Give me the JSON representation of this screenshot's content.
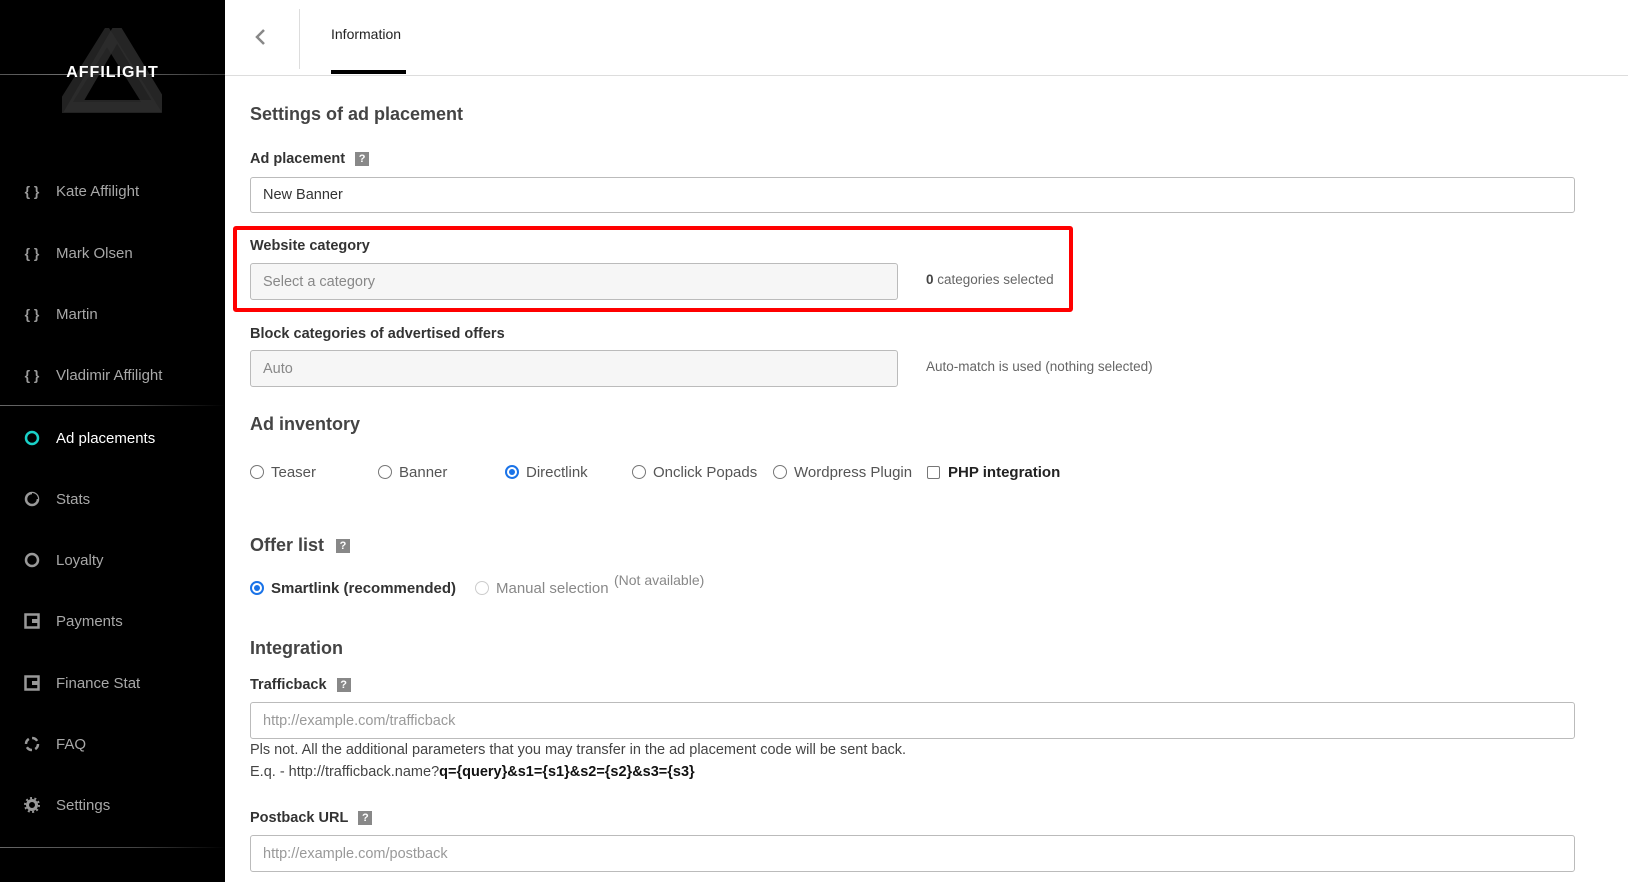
{
  "sidebar": {
    "logo_text": "AFFILIGHT",
    "accounts": [
      {
        "label": "Kate Affilight",
        "icon": "braces-icon"
      },
      {
        "label": "Mark Olsen",
        "icon": "braces-icon"
      },
      {
        "label": "Martin",
        "icon": "braces-icon"
      },
      {
        "label": "Vladimir Affilight",
        "icon": "braces-icon"
      }
    ],
    "items": [
      {
        "label": "Ad placements",
        "icon": "circle-icon",
        "active": true
      },
      {
        "label": "Stats",
        "icon": "pie-icon"
      },
      {
        "label": "Loyalty",
        "icon": "circle-icon"
      },
      {
        "label": "Payments",
        "icon": "wallet-icon"
      },
      {
        "label": "Finance Stat",
        "icon": "wallet-icon"
      },
      {
        "label": "FAQ",
        "icon": "lifebuoy-icon"
      },
      {
        "label": "Settings",
        "icon": "gear-icon"
      }
    ],
    "accent_color": "#1ad1c8"
  },
  "topbar": {
    "back_icon": "chevron-left-icon",
    "tabs": [
      {
        "label": "Information",
        "active": true
      }
    ]
  },
  "form": {
    "section_title": "Settings of ad placement",
    "ad_placement": {
      "label": "Ad placement",
      "value": "New Banner"
    },
    "website_category": {
      "label": "Website category",
      "placeholder": "Select a category",
      "count": "0",
      "count_suffix": " categories selected"
    },
    "block_categories": {
      "label": "Block categories of advertised offers",
      "placeholder": "Auto",
      "note": "Auto-match is used (nothing selected)"
    },
    "ad_inventory": {
      "title": "Ad inventory",
      "options": [
        {
          "label": "Teaser",
          "selected": false
        },
        {
          "label": "Banner",
          "selected": false
        },
        {
          "label": "Directlink",
          "selected": true
        },
        {
          "label": "Onclick Popads",
          "selected": false
        },
        {
          "label": "Wordpress Plugin",
          "selected": false
        }
      ],
      "php_integration": {
        "label": "PHP integration",
        "checked": false
      }
    },
    "offer_list": {
      "title": "Offer list",
      "smartlink": "Smartlink (recommended)",
      "manual": "Manual selection",
      "manual_note": "(Not available)"
    },
    "integration": {
      "title": "Integration",
      "trafficback": {
        "label": "Trafficback",
        "placeholder": "http://example.com/trafficback"
      },
      "note_line1": "Pls not. All the additional parameters that you may transfer in the ad placement code will be sent back.",
      "note_line2_prefix": "E.q. - http://trafficback.name?",
      "note_line2_bold": "q={query}&s1={s1}&s2={s2}&s3={s3}",
      "postback": {
        "label": "Postback URL",
        "placeholder": "http://example.com/postback"
      }
    }
  },
  "help_glyph": "?"
}
